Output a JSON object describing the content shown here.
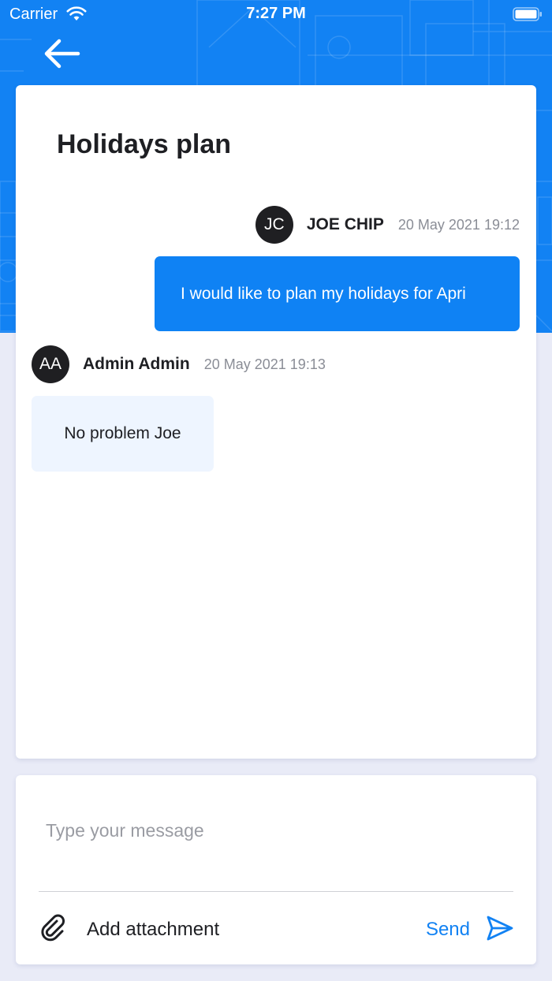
{
  "status_bar": {
    "carrier": "Carrier",
    "time": "7:27 PM",
    "wifi_icon": "wifi-icon",
    "battery_icon": "battery-icon"
  },
  "header": {
    "back_icon": "arrow-left-icon",
    "background_color": "#1282f3"
  },
  "thread": {
    "title": "Holidays plan",
    "messages": [
      {
        "direction": "outgoing",
        "initials": "JC",
        "author": "JOE CHIP",
        "timestamp": "20 May 2021 19:12",
        "text": "I would like to plan my holidays for Apri"
      },
      {
        "direction": "incoming",
        "initials": "AA",
        "author": "Admin Admin",
        "timestamp": "20 May 2021 19:13",
        "text": "No problem Joe"
      }
    ]
  },
  "composer": {
    "placeholder": "Type your message",
    "value": "",
    "attachment_label": "Add attachment",
    "attachment_icon": "paperclip-icon",
    "send_label": "Send",
    "send_icon": "send-icon"
  },
  "colors": {
    "accent": "#1282f3",
    "outgoing_bubble": "#0f82f4",
    "incoming_bubble": "#eef5ff",
    "avatar": "#1f1f22",
    "page_background": "#e9ebf7"
  }
}
